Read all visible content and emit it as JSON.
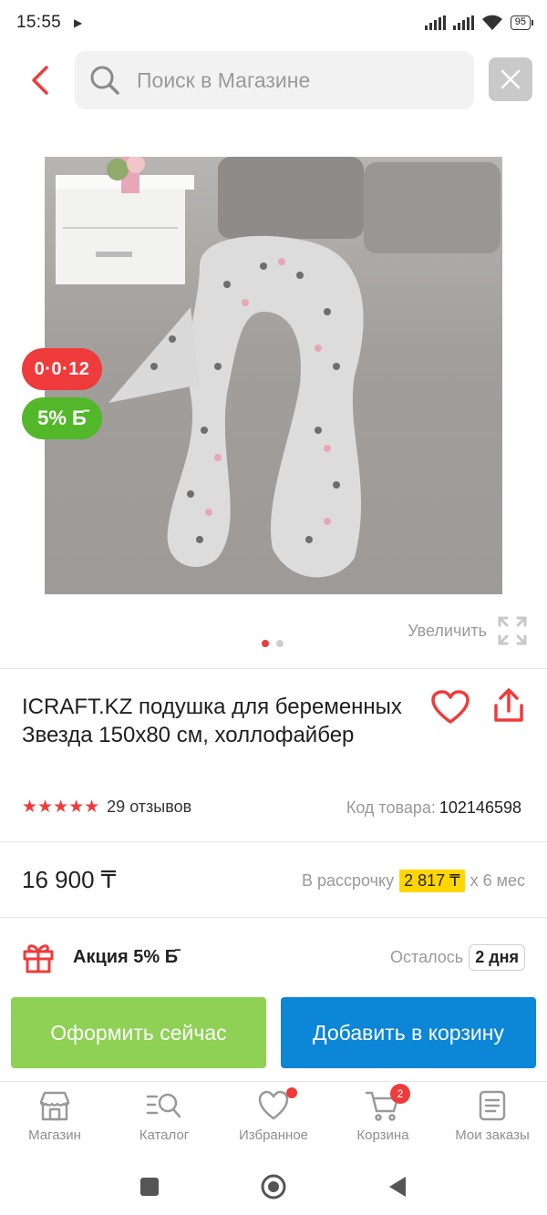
{
  "status": {
    "time": "15:55",
    "battery": "95"
  },
  "search": {
    "placeholder": "Поиск в Магазине"
  },
  "badges": {
    "timer": "0·0·12",
    "bonus": "5% Б̄"
  },
  "gallery": {
    "zoom_label": "Увеличить",
    "slide_count": 2,
    "active_slide": 1
  },
  "product": {
    "title": "ICRAFT.KZ подушка для беременных Звезда 150х80 см, холлофайбер",
    "rating": 5,
    "reviews": "29 отзывов",
    "sku_label": "Код товара:",
    "sku_value": "102146598",
    "price": "16 900 ₸"
  },
  "installment": {
    "prefix": "В рассрочку",
    "amount": "2 817 ₸",
    "suffix": "х 6 мес"
  },
  "promo": {
    "label": "Акция 5% Б̄",
    "remain_label": "Осталось",
    "remain_value": "2 дня"
  },
  "actions": {
    "buy_now": "Оформить сейчас",
    "add_to_cart": "Добавить в корзину"
  },
  "nav": {
    "items": [
      {
        "label": "Магазин",
        "icon": "store-icon"
      },
      {
        "label": "Каталог",
        "icon": "catalog-search-icon"
      },
      {
        "label": "Избранное",
        "icon": "heart-icon"
      },
      {
        "label": "Корзина",
        "icon": "cart-icon",
        "badge": "2"
      },
      {
        "label": "Мои заказы",
        "icon": "orders-icon"
      }
    ]
  },
  "colors": {
    "accent": "#ef3b3b",
    "green": "#52b82a",
    "buy_now": "#8ed155",
    "cart": "#0c86d6",
    "highlight": "#ffd600"
  }
}
